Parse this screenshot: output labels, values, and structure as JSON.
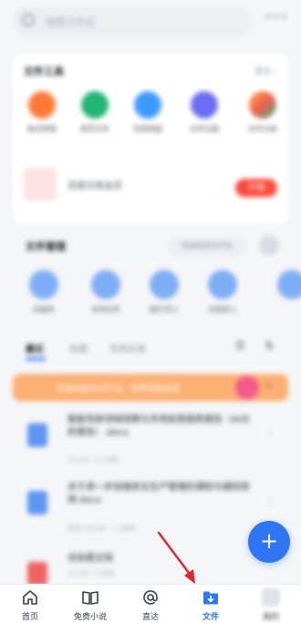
{
  "search": {
    "placeholder": "搜索文件名"
  },
  "tools_card": {
    "title": "文件工具",
    "more": "更多 ›",
    "items": [
      {
        "label": "格式转换",
        "color": "#fb7b35"
      },
      {
        "label": "网页文件",
        "color": "#22b573"
      },
      {
        "label": "百度网盘",
        "color": "#3d9bfc"
      },
      {
        "label": "文件扫描",
        "color": "#6c6ef2"
      },
      {
        "label": "文件分类",
        "color": "#f2b134"
      }
    ],
    "promo_text": "百度文库会员",
    "promo_button": "开通"
  },
  "quick_section": {
    "title": "文件管理",
    "pill": "智能整理文件夹",
    "items": [
      "扫描件",
      "本地文件",
      "图片导入",
      "文档导入"
    ]
  },
  "tabs": {
    "items": [
      "最近",
      "收藏",
      "常用目录"
    ]
  },
  "banner": {
    "text": "百度网盘空间不足，免费领取容量"
  },
  "files": [
    {
      "name": "智能驾驶领域观察与市场前景趋势报告（AI分析报告）.docx",
      "meta": "15:34 · 2.1MB"
    },
    {
      "name": "关于进一步加强安全生产管理的通知与细则安排.docx",
      "meta": "昨天 16:08 · 1.4MB"
    },
    {
      "name": "无标题文档",
      "meta": "12:26 · 12KB"
    }
  ],
  "fab": {
    "label": "+"
  },
  "tabbar": {
    "items": [
      {
        "label": "首页",
        "icon": "home-icon"
      },
      {
        "label": "免费小说",
        "icon": "book-icon"
      },
      {
        "label": "直达",
        "icon": "at-icon"
      },
      {
        "label": "文件",
        "icon": "folder-download-icon",
        "active": true
      },
      {
        "label": "我的",
        "icon": "profile-icon"
      }
    ]
  },
  "colors": {
    "accent": "#2f76f6",
    "arrow": "#e0262e",
    "page_bg": "#f5f6f8"
  }
}
